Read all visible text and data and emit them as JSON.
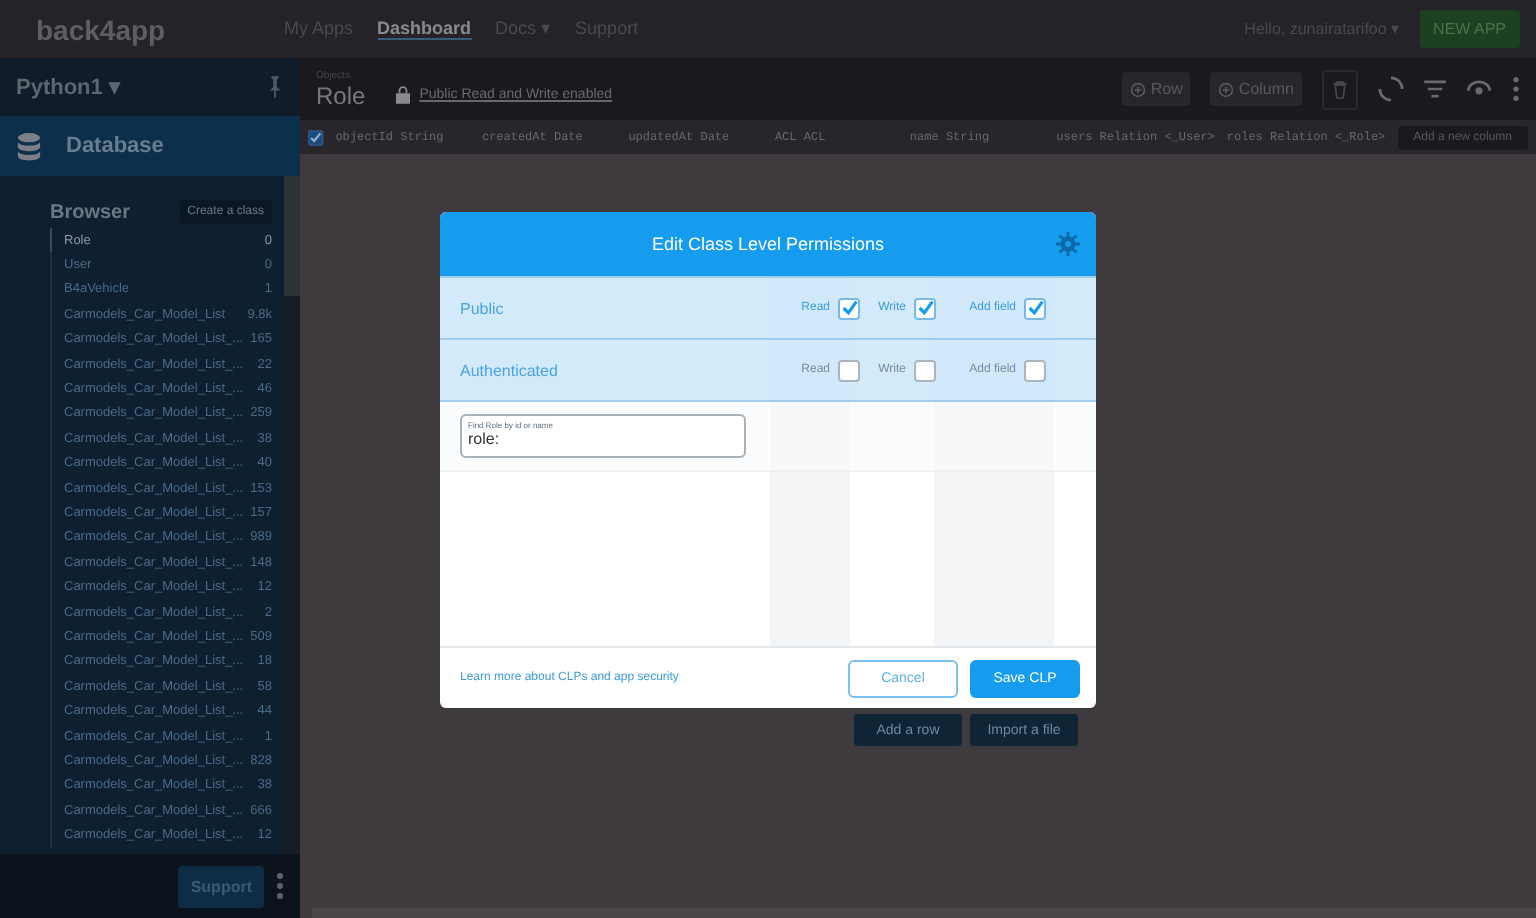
{
  "topbar": {
    "logo": "back4app",
    "nav": [
      {
        "label": "My Apps",
        "selected": false
      },
      {
        "label": "Dashboard",
        "selected": true
      },
      {
        "label": "Docs ▾",
        "selected": false
      },
      {
        "label": "Support",
        "selected": false
      }
    ],
    "user": "Hello, zunairatarifoo ▾",
    "new_app": "NEW APP"
  },
  "sidebar": {
    "app": "Python1 ▾",
    "section": "Database",
    "browser": "Browser",
    "create": "Create a class",
    "classes": [
      {
        "name": "Role",
        "count": "0",
        "selected": true
      },
      {
        "name": "User",
        "count": "0",
        "selected": false
      },
      {
        "name": "B4aVehicle",
        "count": "1",
        "selected": false
      },
      {
        "name": "Carmodels_Car_Model_List",
        "count": "9.8k",
        "selected": false
      },
      {
        "name": "Carmodels_Car_Model_List_...",
        "count": "165",
        "selected": false
      },
      {
        "name": "Carmodels_Car_Model_List_...",
        "count": "22",
        "selected": false
      },
      {
        "name": "Carmodels_Car_Model_List_...",
        "count": "46",
        "selected": false
      },
      {
        "name": "Carmodels_Car_Model_List_...",
        "count": "259",
        "selected": false
      },
      {
        "name": "Carmodels_Car_Model_List_...",
        "count": "38",
        "selected": false
      },
      {
        "name": "Carmodels_Car_Model_List_...",
        "count": "40",
        "selected": false
      },
      {
        "name": "Carmodels_Car_Model_List_...",
        "count": "153",
        "selected": false
      },
      {
        "name": "Carmodels_Car_Model_List_...",
        "count": "157",
        "selected": false
      },
      {
        "name": "Carmodels_Car_Model_List_...",
        "count": "989",
        "selected": false
      },
      {
        "name": "Carmodels_Car_Model_List_...",
        "count": "148",
        "selected": false
      },
      {
        "name": "Carmodels_Car_Model_List_...",
        "count": "12",
        "selected": false
      },
      {
        "name": "Carmodels_Car_Model_List_...",
        "count": "2",
        "selected": false
      },
      {
        "name": "Carmodels_Car_Model_List_...",
        "count": "509",
        "selected": false
      },
      {
        "name": "Carmodels_Car_Model_List_...",
        "count": "18",
        "selected": false
      },
      {
        "name": "Carmodels_Car_Model_List_...",
        "count": "58",
        "selected": false
      },
      {
        "name": "Carmodels_Car_Model_List_...",
        "count": "44",
        "selected": false
      },
      {
        "name": "Carmodels_Car_Model_List_...",
        "count": "1",
        "selected": false
      },
      {
        "name": "Carmodels_Car_Model_List_...",
        "count": "828",
        "selected": false
      },
      {
        "name": "Carmodels_Car_Model_List_...",
        "count": "38",
        "selected": false
      },
      {
        "name": "Carmodels_Car_Model_List_...",
        "count": "666",
        "selected": false
      },
      {
        "name": "Carmodels_Car_Model_List_...",
        "count": "12",
        "selected": false
      }
    ],
    "support": "Support"
  },
  "content": {
    "breadcrumb": "Objects",
    "title": "Role",
    "access": "Public Read and Write enabled",
    "toolbar": [
      "Row",
      "Column"
    ],
    "columns": [
      {
        "name": "objectId",
        "type": "String"
      },
      {
        "name": "createdAt",
        "type": "Date"
      },
      {
        "name": "updatedAt",
        "type": "Date"
      },
      {
        "name": "ACL",
        "type": "ACL"
      },
      {
        "name": "name",
        "type": "String"
      },
      {
        "name": "users",
        "type": "Relation <_User>"
      },
      {
        "name": "roles",
        "type": "Relation <_Role>"
      }
    ],
    "select_all": {
      "checked": true
    },
    "add_column": "Add a new column",
    "empty_actions": [
      "Add a row",
      "Import a file"
    ]
  },
  "modal": {
    "title": "Edit Class Level Permissions",
    "rows": [
      {
        "label": "Public",
        "permissions": [
          {
            "label": "Read",
            "checked": true
          },
          {
            "label": "Write",
            "checked": true
          },
          {
            "label": "Add field",
            "checked": true
          }
        ]
      },
      {
        "label": "Authenticated",
        "permissions": [
          {
            "label": "Read",
            "checked": false
          },
          {
            "label": "Write",
            "checked": false
          },
          {
            "label": "Add field",
            "checked": false
          }
        ]
      }
    ],
    "search": {
      "placeholder": "Find Role by id or name",
      "value": "role:"
    },
    "link": "Learn more about CLPs and app security",
    "cancel": "Cancel",
    "save": "Save CLP"
  }
}
